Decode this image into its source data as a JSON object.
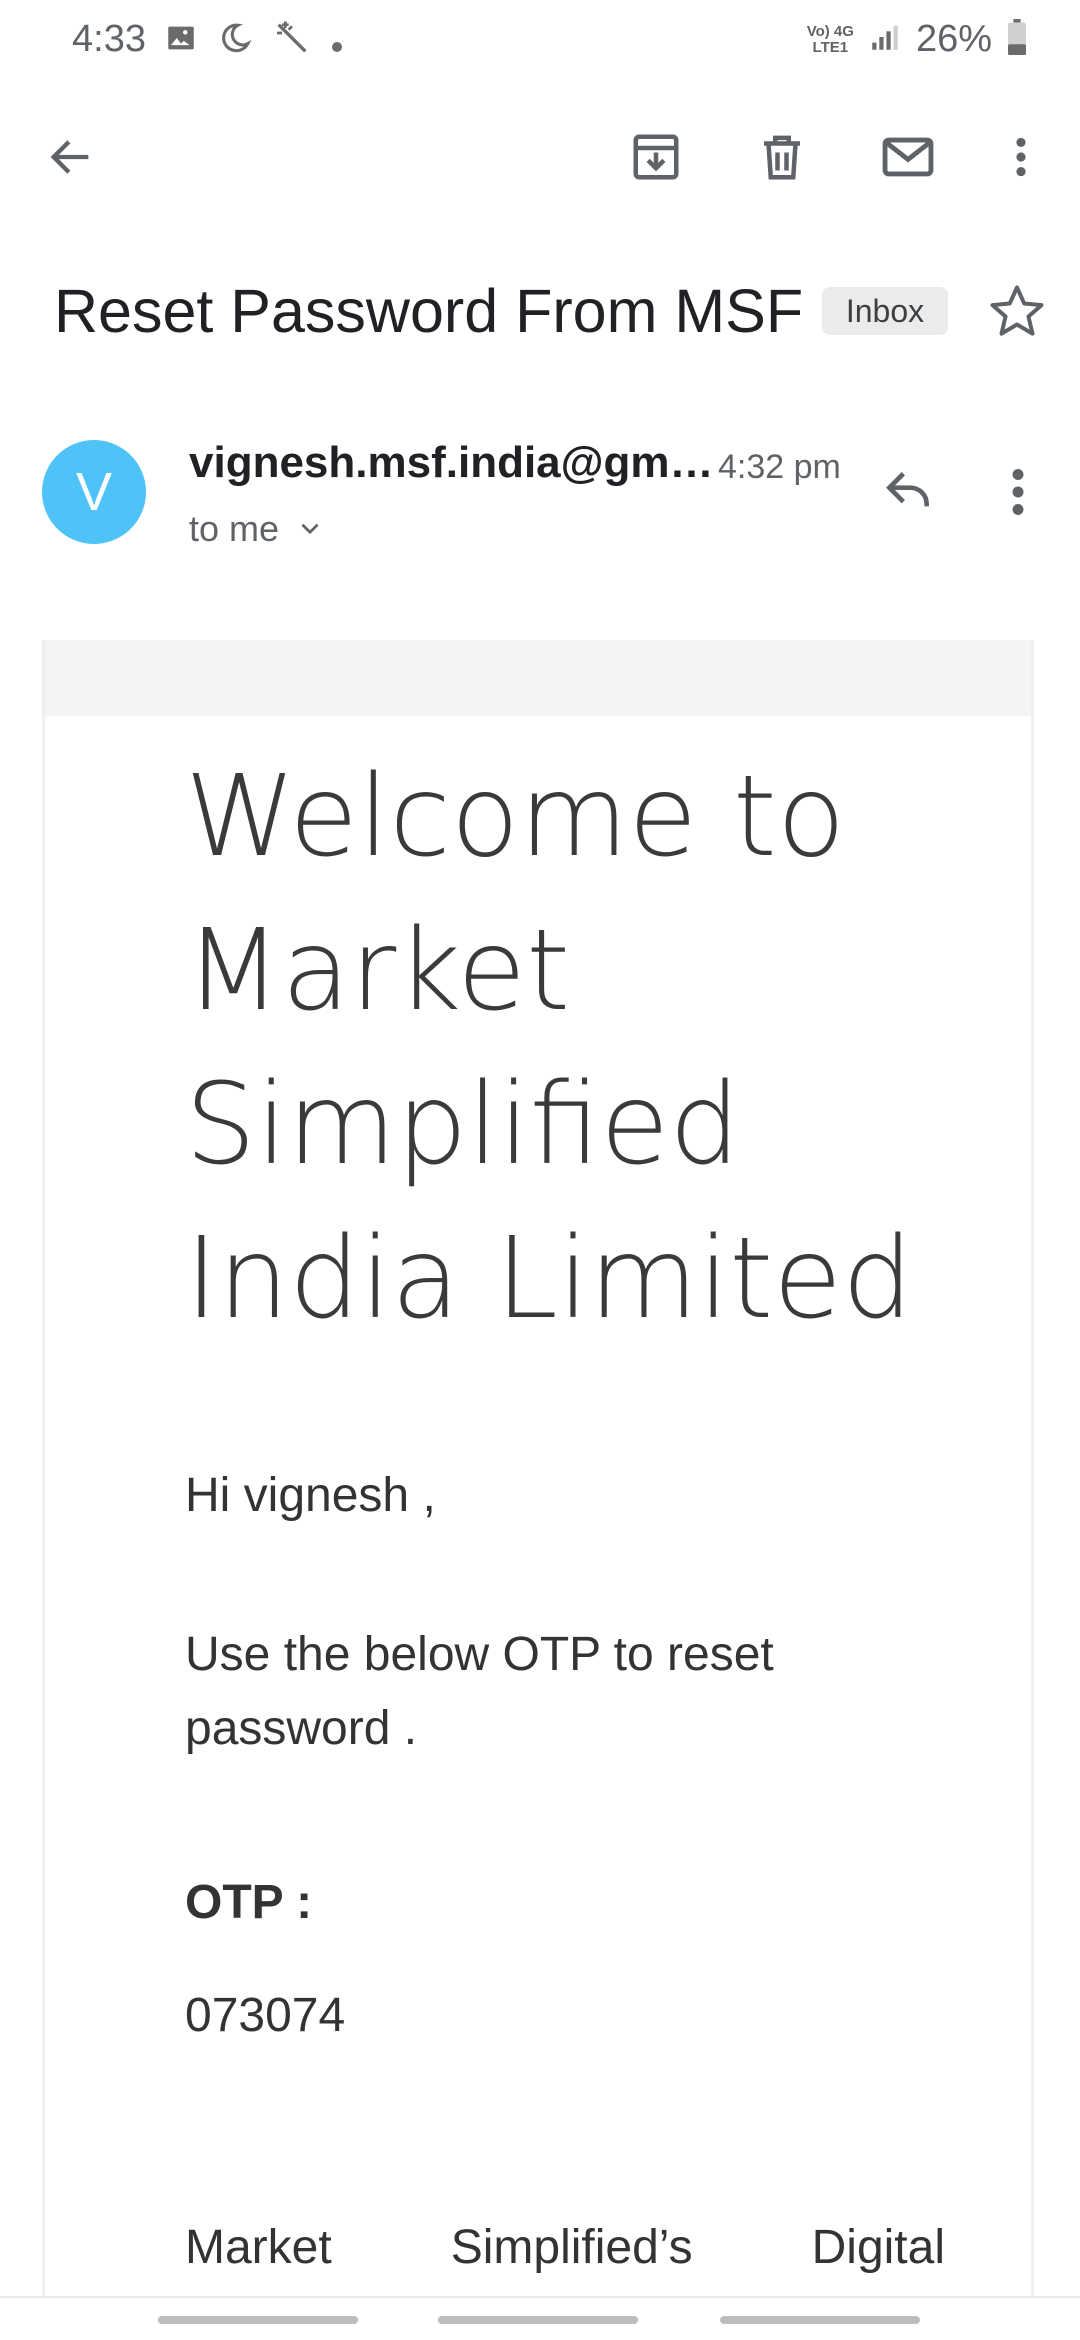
{
  "status_bar": {
    "time": "4:33",
    "net_line1": "Vo) 4G",
    "net_line2": "LTE1",
    "battery": "26%"
  },
  "app_bar": {
    "icons": [
      "back-arrow-icon",
      "archive-icon",
      "delete-icon",
      "mark-unread-icon",
      "more-vert-icon"
    ]
  },
  "email": {
    "subject": "Reset Password From MSF",
    "label": "Inbox",
    "sender_initial": "V",
    "sender": "vignesh.msf.india@gm…",
    "time": "4:32 pm",
    "recipient": "to me",
    "body": {
      "welcome_line1": "Welcome to",
      "welcome_line2": "Market",
      "welcome_line3": "Simplified",
      "welcome_line4": "India Limited",
      "greeting": "Hi vignesh ,",
      "instruction": "Use the below OTP to reset password .",
      "otp_label": "OTP :",
      "otp_value": "073074",
      "footer_word1": "Market",
      "footer_word2": "Simplified’s",
      "footer_word3": "Digital"
    }
  },
  "colors": {
    "avatar": "#4fc3f7",
    "chip_bg": "#ebebeb",
    "icon": "#5f6368"
  }
}
